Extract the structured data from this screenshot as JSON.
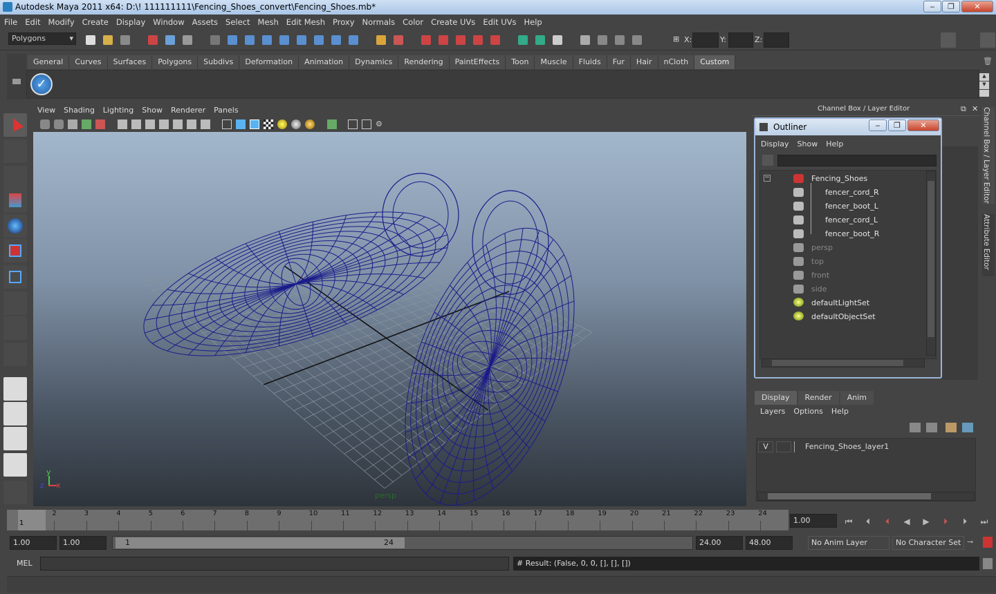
{
  "window": {
    "title": "Autodesk Maya 2011 x64: D:\\! 111111111\\Fencing_Shoes_convert\\Fencing_Shoes.mb*",
    "minimize": "‒",
    "maximize": "❐",
    "close": "✕"
  },
  "menubar": [
    "File",
    "Edit",
    "Modify",
    "Create",
    "Display",
    "Window",
    "Assets",
    "Select",
    "Mesh",
    "Edit Mesh",
    "Proxy",
    "Normals",
    "Color",
    "Create UVs",
    "Edit UVs",
    "Help"
  ],
  "statusline": {
    "mode": "Polygons",
    "x_label": "X:",
    "y_label": "Y:",
    "z_label": "Z:"
  },
  "shelf_tabs": [
    "General",
    "Curves",
    "Surfaces",
    "Polygons",
    "Subdivs",
    "Deformation",
    "Animation",
    "Dynamics",
    "Rendering",
    "PaintEffects",
    "Toon",
    "Muscle",
    "Fluids",
    "Fur",
    "Hair",
    "nCloth",
    "Custom"
  ],
  "shelf_active": "Custom",
  "viewport": {
    "menu": [
      "View",
      "Shading",
      "Lighting",
      "Show",
      "Renderer",
      "Panels"
    ],
    "camera_label": "persp",
    "axis_x": "x",
    "axis_y": "y",
    "axis_z": "z",
    "wire_color": "#1b1b8a"
  },
  "right_panel": {
    "title": "Channel Box / Layer Editor",
    "vertical_tab_1": "Channel Box / Layer Editor",
    "vertical_tab_2": "Attribute Editor"
  },
  "outliner": {
    "title": "Outliner",
    "menu": [
      "Display",
      "Show",
      "Help"
    ],
    "items": [
      {
        "label": "Fencing_Shoes",
        "dim": false
      },
      {
        "label": "fencer_cord_R",
        "dim": false
      },
      {
        "label": "fencer_boot_L",
        "dim": false
      },
      {
        "label": "fencer_cord_L",
        "dim": false
      },
      {
        "label": "fencer_boot_R",
        "dim": false
      },
      {
        "label": "persp",
        "dim": true
      },
      {
        "label": "top",
        "dim": true
      },
      {
        "label": "front",
        "dim": true
      },
      {
        "label": "side",
        "dim": true
      },
      {
        "label": "defaultLightSet",
        "dim": false
      },
      {
        "label": "defaultObjectSet",
        "dim": false
      }
    ]
  },
  "layer_editor": {
    "tabs": [
      "Display",
      "Render",
      "Anim"
    ],
    "menu": [
      "Layers",
      "Options",
      "Help"
    ],
    "visibility": "V",
    "layer_name": "Fencing_Shoes_layer1"
  },
  "timeline": {
    "ticks": [
      "1",
      "2",
      "3",
      "4",
      "5",
      "6",
      "7",
      "8",
      "9",
      "10",
      "11",
      "12",
      "13",
      "14",
      "15",
      "16",
      "17",
      "18",
      "19",
      "20",
      "21",
      "22",
      "23",
      "24"
    ],
    "current_marker": "1",
    "current_time": "1.00"
  },
  "range": {
    "start": "1.00",
    "playback_start": "1.00",
    "slider_start": "1",
    "slider_end": "24",
    "playback_end": "24.00",
    "end": "48.00",
    "anim_layer": "No Anim Layer",
    "character_set": "No Character Set"
  },
  "command": {
    "lang": "MEL",
    "result": "# Result: (False, 0, 0, [], [], [])"
  }
}
